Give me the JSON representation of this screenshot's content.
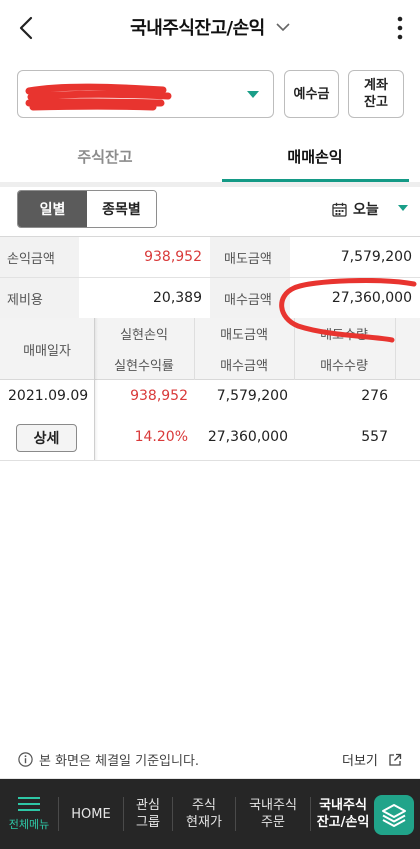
{
  "header": {
    "title": "국내주식잔고/손익",
    "icons": {
      "back": "chevron-left-icon",
      "title_toggle": "chevron-down-icon",
      "more": "kebab-menu-icon"
    }
  },
  "account": {
    "selected_value": "",
    "buttons": {
      "deposit": "예수금",
      "account_balance": "계좌\n잔고"
    }
  },
  "tabs": [
    {
      "label": "주식잔고",
      "active": false
    },
    {
      "label": "매매손익",
      "active": true
    }
  ],
  "filter": {
    "segment": [
      {
        "label": "일별",
        "active": true
      },
      {
        "label": "종목별",
        "active": false
      }
    ],
    "date_label": "오늘"
  },
  "summary": {
    "profit_amount": {
      "label": "손익금액",
      "value": "938,952"
    },
    "sell_amount": {
      "label": "매도금액",
      "value": "7,579,200"
    },
    "fees": {
      "label": "제비용",
      "value": "20,389"
    },
    "buy_amount": {
      "label": "매수금액",
      "value": "27,360,000"
    }
  },
  "table": {
    "headers": {
      "date": "매매일자",
      "realized_profit": "실현손익",
      "realized_rate": "실현수익률",
      "sell_amount": "매도금액",
      "buy_amount": "매수금액",
      "sell_qty": "매도수량",
      "buy_qty": "매수수량"
    },
    "rows": [
      {
        "date": "2021.09.09",
        "detail_button": "상세",
        "realized_profit": "938,952",
        "realized_rate": "14.20%",
        "sell_amount": "7,579,200",
        "buy_amount": "27,360,000",
        "sell_qty": "276",
        "buy_qty": "557"
      }
    ]
  },
  "footer_note": {
    "text": "본 화면은 체결일 기준입니다.",
    "more": "더보기"
  },
  "bottom_nav": {
    "menu_label": "전체메뉴",
    "items": [
      {
        "label": "HOME"
      },
      {
        "label": "관심\n그룹"
      },
      {
        "label": "주식\n현재가"
      },
      {
        "label": "국내주식\n주문"
      },
      {
        "label": "국내주식\n잔고/손익",
        "active": true
      }
    ]
  },
  "colors": {
    "accent": "#149a86",
    "profit_red": "#d93a3a",
    "nav_bg": "#262626",
    "annotation_red": "#e8342f"
  }
}
